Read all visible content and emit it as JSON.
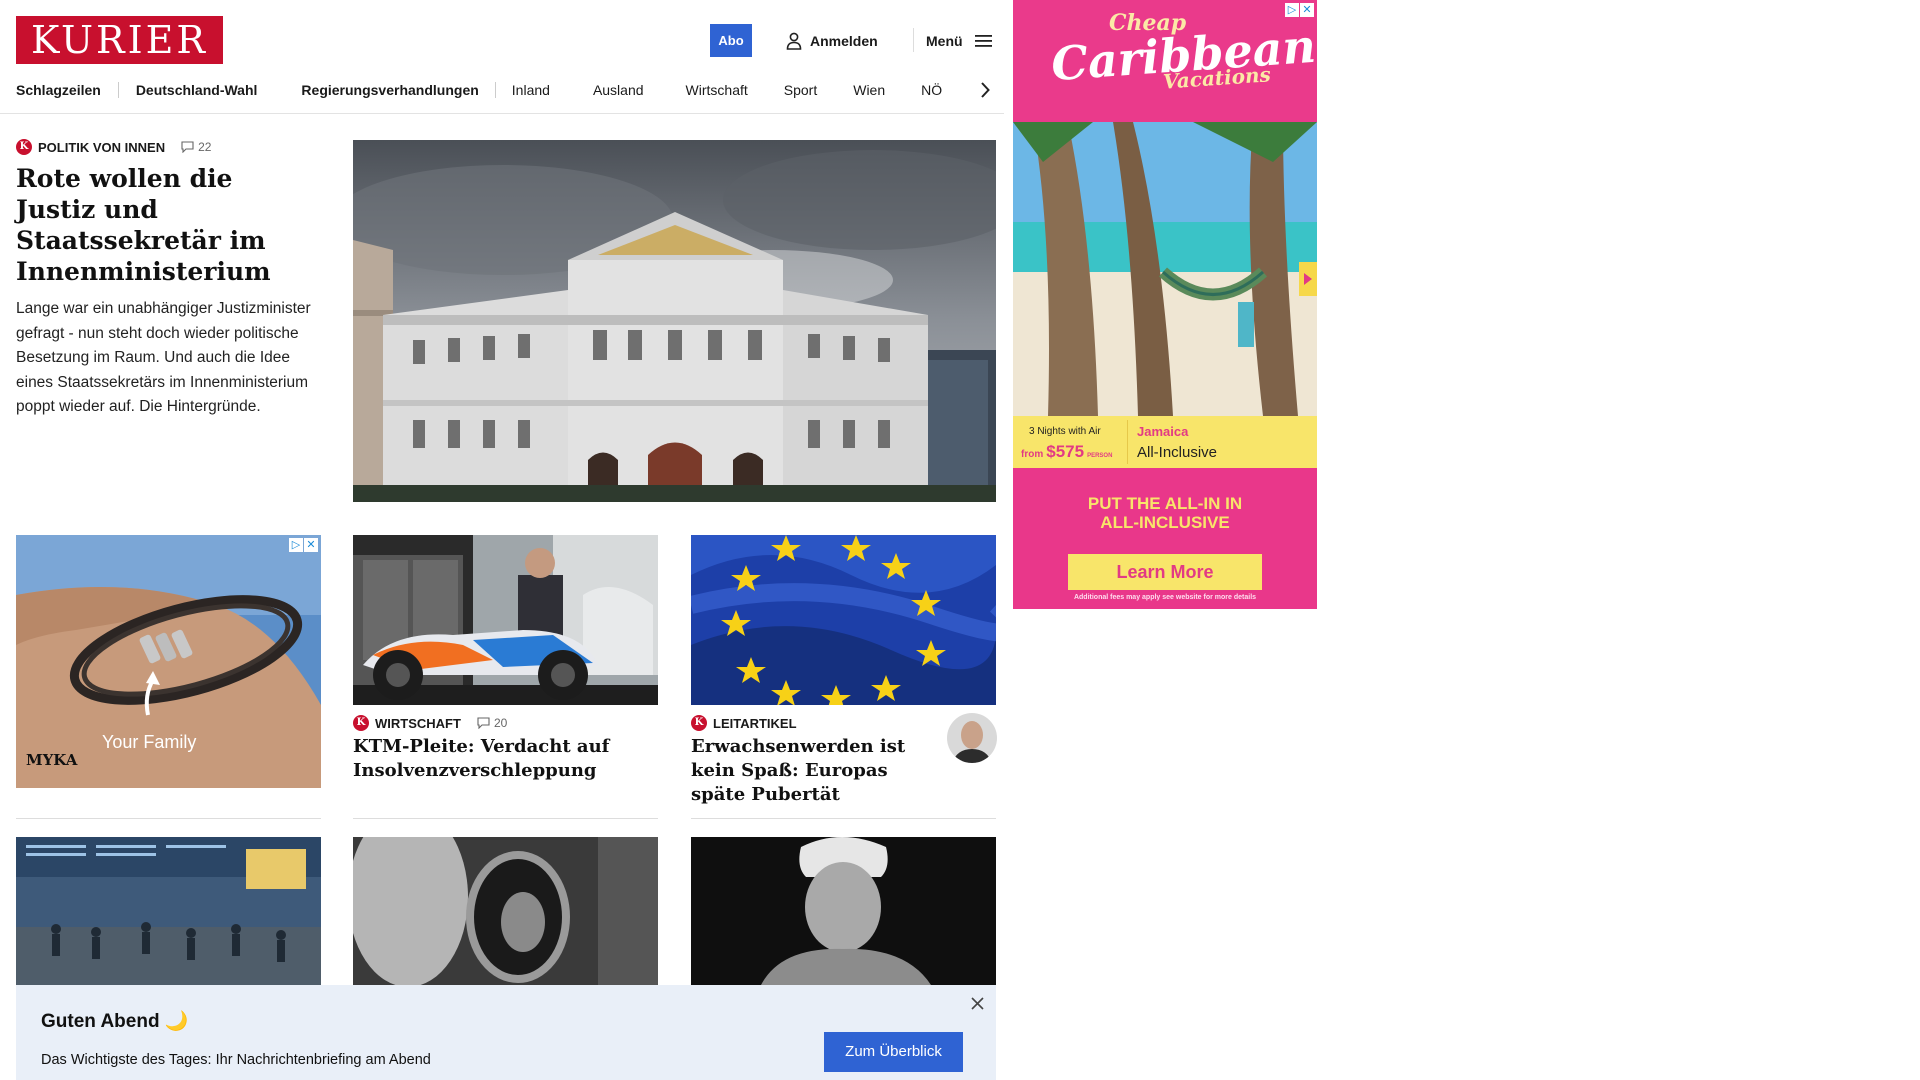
{
  "header": {
    "logo_text": "KURIER",
    "abo_label": "Abo",
    "login_label": "Anmelden",
    "menu_label": "Menü",
    "brand_color": "#c8102e",
    "accent_color": "#2f63d3"
  },
  "nav": {
    "items": [
      "Schlagzeilen",
      "Deutschland-Wahl",
      "Regierungsverhandlungen",
      "Inland",
      "Ausland",
      "Wirtschaft",
      "Sport",
      "Wien",
      "NÖ"
    ]
  },
  "lead": {
    "section": "POLITIK VON INNEN",
    "comments": "22",
    "title": "Rote wollen die Justiz und Staatssekretär im Innenministerium",
    "teaser": "Lange war ein unabhängiger Justizminister gefragt - nun steht doch wieder politische Besetzung im Raum. Und auch die Idee eines Staatssekretärs im Innenministerium poppt wieder auf. Die Hintergründe."
  },
  "ad_small": {
    "caption": "Your Family",
    "brand": "MYKA"
  },
  "articles": [
    {
      "section": "WIRTSCHAFT",
      "comments": "20",
      "title": "KTM-Pleite: Verdacht auf Insolvenzverschleppung"
    },
    {
      "section": "LEITARTIKEL",
      "title": "Erwachsenwerden ist kein Spaß: Europas späte Pubertät"
    }
  ],
  "side_ad": {
    "headline_1": "Cheap",
    "headline_2": "Caribbean",
    "headline_3": "Vacations",
    "nights": "3 Nights with Air",
    "from": "from",
    "price": "$575",
    "per": "PERSON",
    "destination": "Jamaica",
    "package": "All-Inclusive",
    "slogan_1": "PUT THE ALL-IN IN",
    "slogan_2": "ALL-INCLUSIVE",
    "cta": "Learn More",
    "fine_print": "Additional fees may apply see website for more details"
  },
  "briefing": {
    "title": "Guten Abend 🌙",
    "text": "Das Wichtigste des Tages: Ihr Nachrichtenbriefing am Abend",
    "button": "Zum Überblick"
  }
}
